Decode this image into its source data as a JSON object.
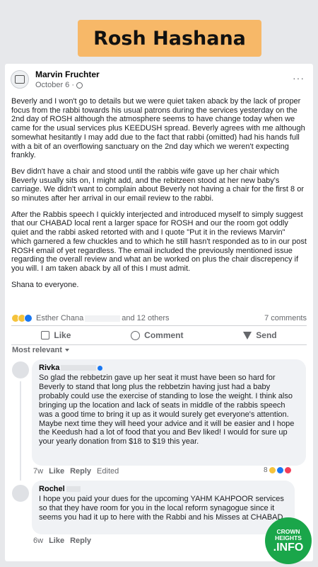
{
  "banner": {
    "title": "Rosh Hashana"
  },
  "post": {
    "author": "Marvin Fruchter",
    "date": "October 6 ·",
    "more": "···",
    "paragraphs": [
      "Beverly and I won't go to details but we were quiet taken aback by the lack of proper focus from the rabbi towards his usual patrons during the services yesterday on the 2nd day of ROSH although the atmosphere seems to have change today when we came for the usual services plus KEEDUSH spread. Beverly agrees with me although somewhat hesitantly I may add due to the fact that rabbi (omitted) had his hands full with a bit of an overflowing sanctuary on the 2nd day which we weren't expecting frankly.",
      "Bev didn't have a chair and stood until the rabbis wife gave up her chair which Beverly usually sits on, I might add, and the rebitzeen stood at her new baby's carriage.  We didn't want to complain about Beverly not having a chair for the first 8 or so minutes after her arrival in our email review to the rabbi.",
      "After the Rabbis speech I quickly interjected and introduced myself to simply suggest that our CHABAD local rent a larger space for ROSH and our the room got oddly quiet and the rabbi asked retorted with and I quote \"Put it in the reviews Marvin\" which garnered a few chuckles and to which he still hasn't responded as to in our post ROSH email of yet regardless. The email included the previously mentioned issue regarding the overall review and what an be worked on plus the chair discrepency if you will. I am taken aback by all of this I must admit.",
      "Shana to everyone."
    ],
    "reactors_first": "Esther Chana",
    "reactors_rest": "and 12 others",
    "comments_count": "7 comments",
    "actions": {
      "like": "Like",
      "comment": "Comment",
      "send": "Send"
    },
    "sort_label": "Most relevant"
  },
  "comments": [
    {
      "name": "Rivka",
      "text": "So glad the rebbetzin gave up her seat it must have been so hard for Beverly to stand that long plus the rebbetzin having just had a baby probably could use the exercise of standing to lose the weight. I think also bringing up the location and lack of seats in middle of the rabbis speech was a good time to bring it up as it would surely get everyone's attention. Maybe next time they will heed your advice and it will be easier and I hope the Keedush had a lot of food that you and Bev liked! I would for sure up your yearly donation from $18 to $19 this year.",
      "time": "7w",
      "like": "Like",
      "reply": "Reply",
      "edited": "Edited",
      "reaction_count": "8"
    },
    {
      "name": "Rochel",
      "text": "I hope you paid your dues for the upcoming YAHM KAHPOOR services so that they have room for you in the local reform synagogue since it seems you had it up to here with the Rabbi and his Misses at CHABAD",
      "time": "6w",
      "like": "Like",
      "reply": "Reply"
    }
  ],
  "watermark": {
    "line1": "CROWN",
    "line2": "HEIGHTS",
    "line3": ".INFO"
  },
  "colors": {
    "banner": "#f7b868",
    "logo": "#1aa64a",
    "like_blue": "#1877f2"
  }
}
